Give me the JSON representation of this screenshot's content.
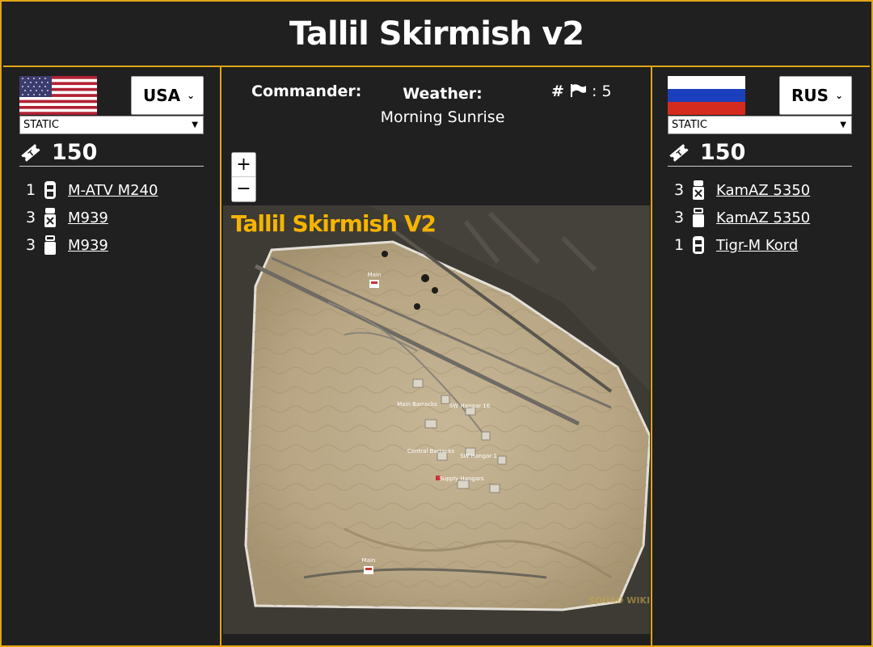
{
  "header": {
    "title": "Tallil Skirmish v2"
  },
  "team1": {
    "faction": "USA",
    "preset": "STATIC",
    "tickets": "150",
    "vehicles": [
      {
        "count": "1",
        "name": "M-ATV M240",
        "icon": "mrap-icon"
      },
      {
        "count": "3",
        "name": "M939",
        "icon": "logistics-truck-icon"
      },
      {
        "count": "3",
        "name": "M939",
        "icon": "transport-truck-icon"
      }
    ]
  },
  "team2": {
    "faction": "RUS",
    "preset": "STATIC",
    "tickets": "150",
    "vehicles": [
      {
        "count": "3",
        "name": "KamAZ 5350",
        "icon": "logistics-truck-icon"
      },
      {
        "count": "3",
        "name": "KamAZ 5350",
        "icon": "transport-truck-icon"
      },
      {
        "count": "1",
        "name": "Tigr-M Kord",
        "icon": "mrap-icon"
      }
    ]
  },
  "center": {
    "commander_label": "Commander:",
    "commander_value": "",
    "weather_label": "Weather:",
    "weather_value": "Morning Sunrise",
    "caps_prefix": "#",
    "caps_suffix": ": 5"
  },
  "map": {
    "title": "Tallil Skirmish V2",
    "labels": [
      "Main",
      "Main",
      "Main Barracks",
      "SW Hangar 16",
      "Central Barracks",
      "SW Hangar 1",
      "Supply Hangars"
    ],
    "watermark": "SQUAD WIKI"
  },
  "zoom": {
    "in": "+",
    "out": "−"
  },
  "colors": {
    "accent": "#e0a516",
    "background": "#202020",
    "map_title": "#f5b400"
  }
}
